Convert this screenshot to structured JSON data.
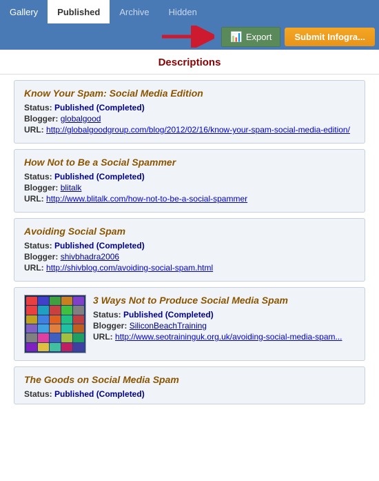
{
  "tabs": [
    {
      "id": "gallery",
      "label": "Gallery",
      "active": false
    },
    {
      "id": "published",
      "label": "Published",
      "active": true
    },
    {
      "id": "archive",
      "label": "Archive",
      "active": false
    },
    {
      "id": "hidden",
      "label": "Hidden",
      "active": false
    }
  ],
  "toolbar": {
    "export_label": "Export",
    "submit_label": "Submit Infogra..."
  },
  "section_title": "Descriptions",
  "cards": [
    {
      "title": "Know Your Spam: Social Media Edition",
      "status": "Published (Completed)",
      "blogger": "globalgood",
      "url": "http://globalgoodgroup.com/blog/2012/02/16/know-your-spam-social-media-edition/"
    },
    {
      "title": "How Not to Be a Social Spammer",
      "status": "Published (Completed)",
      "blogger": "blitalk",
      "url": "http://www.blitalk.com/how-not-to-be-a-social-spammer"
    },
    {
      "title": "Avoiding Social Spam",
      "status": "Published (Completed)",
      "blogger": "shivbhadra2006",
      "url": "http://shivblog.com/avoiding-social-spam.html"
    },
    {
      "title": "3 Ways Not to Produce Social Media Spam",
      "status": "Published (Completed)",
      "blogger": "SiliconBeachTraining",
      "url": "http://www.seotraininguk.org.uk/avoiding-social-media-spam...",
      "hasThumb": true
    },
    {
      "title": "The Goods on Social Media Spam",
      "status": "Published (Completed)",
      "blogger": "",
      "url": "",
      "partial": true
    }
  ],
  "labels": {
    "status": "Status:",
    "blogger": "Blogger:",
    "url": "URL:"
  },
  "thumb_colors": [
    "#e84040",
    "#4040c8",
    "#40a040",
    "#c88020",
    "#8040c8",
    "#e84040",
    "#20a0c0",
    "#c84040",
    "#40c040",
    "#808080",
    "#c0a020",
    "#4080e0",
    "#e06020",
    "#20c080",
    "#c04040",
    "#8060c0",
    "#40a0e0",
    "#e08040",
    "#20c0a0",
    "#c06020",
    "#808080",
    "#e040a0",
    "#4060c0",
    "#a0c040",
    "#20a060",
    "#8020c0",
    "#e0c040",
    "#40c0a0",
    "#c02060",
    "#4040a0"
  ]
}
